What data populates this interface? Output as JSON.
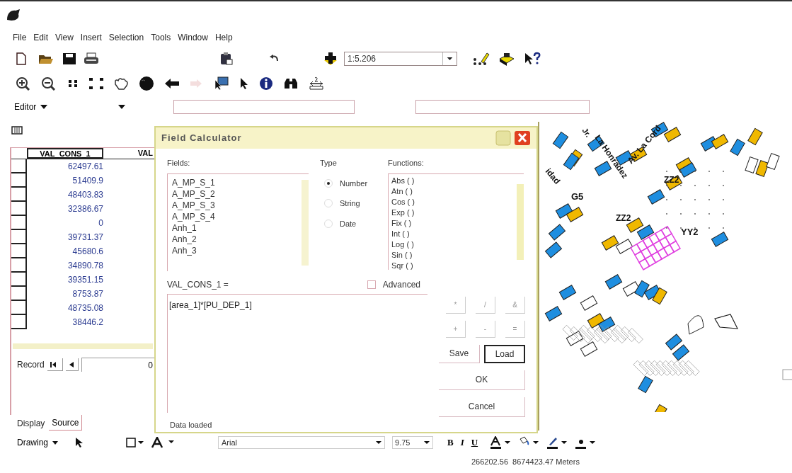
{
  "menu": [
    "File",
    "Edit",
    "View",
    "Insert",
    "Selection",
    "Tools",
    "Window",
    "Help"
  ],
  "scale": "1:5.206",
  "editor": {
    "label": "Editor"
  },
  "table": {
    "columns": [
      "VAL_CONS_1",
      "VAL"
    ],
    "rows": [
      "62497.61",
      "51409.9",
      "48403.83",
      "32386.67",
      "0",
      "39731.37",
      "45680.6",
      "34890.78",
      "39351.15",
      "8753.87",
      "48735.08",
      "38446.2"
    ],
    "record_label": "Record",
    "record_value": "0"
  },
  "view_tabs": [
    {
      "label": "Display",
      "selected": false
    },
    {
      "label": "Source",
      "selected": true
    }
  ],
  "dialog": {
    "title": "Field Calculator",
    "fields_label": "Fields:",
    "fields": [
      "A_MP_S_1",
      "A_MP_S_2",
      "A_MP_S_3",
      "A_MP_S_4",
      "Anh_1",
      "Anh_2",
      "Anh_3"
    ],
    "type_label": "Type",
    "types": [
      {
        "label": "Number",
        "selected": true
      },
      {
        "label": "String",
        "selected": false
      },
      {
        "label": "Date",
        "selected": false
      }
    ],
    "functions_label": "Functions:",
    "functions": [
      "Abs ( )",
      "Atn ( )",
      "Cos ( )",
      "Exp ( )",
      "Fix ( )",
      "Int ( )",
      "Log ( )",
      "Sin ( )",
      "Sqr ( )"
    ],
    "expression_label": "VAL_CONS_1 =",
    "advanced": {
      "label": "Advanced",
      "checked": false
    },
    "expression": "[area_1]*[PU_DEP_1]",
    "operators": [
      "*",
      "/",
      "&",
      "+",
      "-",
      "="
    ],
    "buttons": [
      "Save",
      "Load",
      "OK",
      "Cancel"
    ],
    "status": "Data loaded"
  },
  "map_labels": [
    "Jr.",
    "La Honradez",
    "Av. La Cord",
    "idad",
    "G5",
    "ZZ2",
    "ZZ2",
    "YY2"
  ],
  "drawing_toolbar": {
    "label": "Drawing",
    "font": "Arial",
    "size": "9.75",
    "styles": [
      "B",
      "I",
      "U"
    ]
  },
  "status_bar": "266202.56  8674423.47 Meters"
}
